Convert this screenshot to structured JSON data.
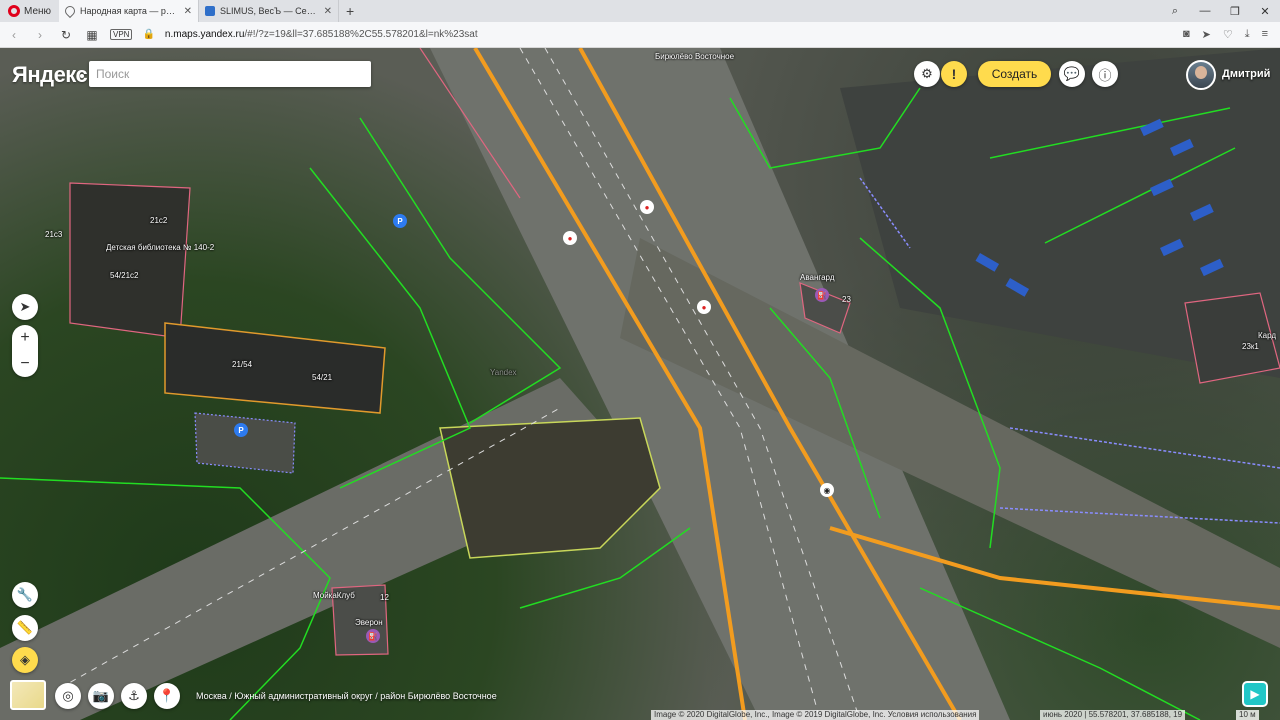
{
  "browser": {
    "menu_label": "Меню",
    "tabs": [
      {
        "title": "Народная карта — редакт",
        "active": true
      },
      {
        "title": "SLIMUS, ВесЪ — Сектор П",
        "active": false
      }
    ],
    "vpn_label": "VPN",
    "url_host": "n.maps.yandex.ru",
    "url_rest": "/#!/?z=19&ll=37.685188%2C55.578201&l=nk%23sat"
  },
  "app": {
    "logo": "Яндекс",
    "search_placeholder": "Поиск",
    "create_label": "Создать",
    "warn_label": "!",
    "user_name": "Дмитрий"
  },
  "map": {
    "labels": {
      "area": "Бирюлёво Восточное",
      "building_21c2": "21с2",
      "library": "Детская библиотека № 140-2",
      "building_54_21c2": "54/21с2",
      "building_21c3": "21с3",
      "building_21_54": "21/54",
      "building_54_21": "54/21",
      "avangard": "Авангард",
      "avangard_no": "23",
      "building_23k1": "23к1",
      "kard": "Кард",
      "moika": "МойкаКлуб",
      "moika_no": "12",
      "everon": "Эверон",
      "yandex_wm": "Yandex"
    },
    "breadcrumb": "Москва / Южный административный округ / район Бирюлёво Восточное",
    "copyright": "Image © 2020 DigitalGlobe, Inc., Image © 2019 DigitalGlobe, Inc. Условия использования",
    "imagery_date": "июнь 2020",
    "coords": "55.578201, 37.685188, 19",
    "scale": "10 м"
  }
}
